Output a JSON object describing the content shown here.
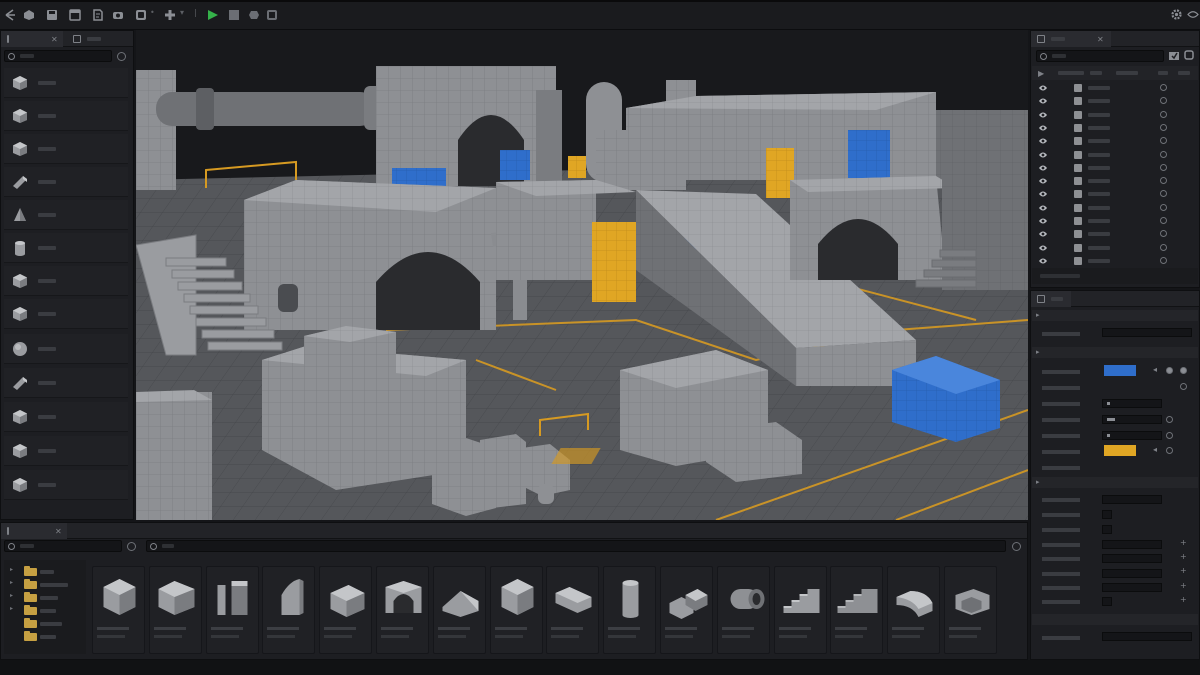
{
  "toolbar": {
    "icons": [
      "back-arrow-icon",
      "select-icon",
      "save-icon",
      "document-icon",
      "camera-icon",
      "grid-icon",
      "transform-icon",
      "play-icon",
      "stop-icon",
      "record-icon",
      "settings-gear-icon"
    ],
    "play_color": "#35b24a"
  },
  "left_panel": {
    "tabs": [
      "objects-tab",
      "assets-tab"
    ],
    "items": [
      "cube",
      "cube",
      "cube",
      "wedge",
      "cone",
      "cylinder",
      "cube",
      "cube",
      "sphere",
      "wedge",
      "cube",
      "cube",
      "cube"
    ]
  },
  "scene": {
    "accent_blue": "#2f6ecb",
    "accent_yellow": "#e0a624",
    "blockout_gray": "#8d8f93"
  },
  "outliner": {
    "row_count": 14
  },
  "details": {
    "color_swatches": [
      "#2f6ecb",
      "#e0a624"
    ]
  },
  "content_browser": {
    "folder_color": "#c6a042",
    "assets": [
      "cube",
      "cube-wide",
      "columns",
      "quarter-wall",
      "box",
      "arch",
      "ramp",
      "cube",
      "beam",
      "cylinder",
      "corner-block",
      "pipe",
      "stairs",
      "stairs-wide",
      "curved-wall",
      "ledge"
    ]
  }
}
